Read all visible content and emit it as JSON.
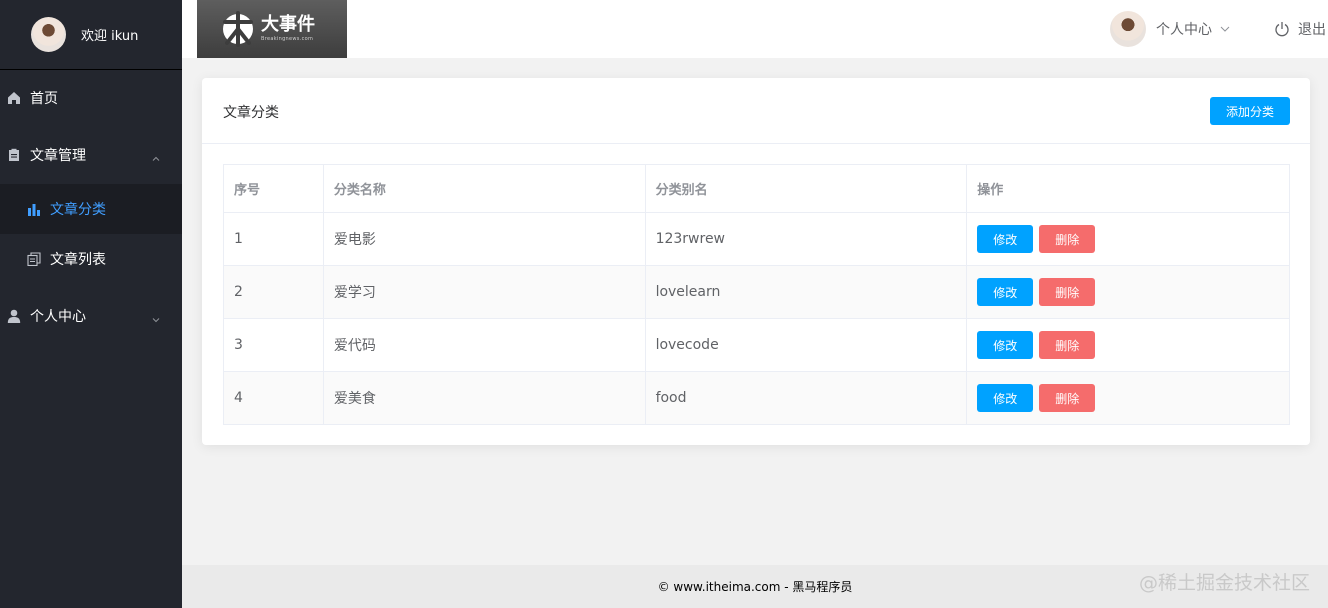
{
  "sidebar": {
    "welcome": "欢迎 ikun",
    "menu": [
      {
        "label": "首页",
        "icon": "home-icon"
      },
      {
        "label": "文章管理",
        "icon": "document-icon",
        "expanded": true
      },
      {
        "label": "文章分类",
        "icon": "bar-chart-icon",
        "active": true
      },
      {
        "label": "文章列表",
        "icon": "copy-icon"
      },
      {
        "label": "个人中心",
        "icon": "user-icon",
        "expanded": false
      }
    ]
  },
  "header": {
    "logo_title": "大事件",
    "logo_sub": "Breakingnews.com",
    "user_label": "个人中心",
    "logout_label": "退出"
  },
  "card": {
    "title": "文章分类",
    "add_button": "添加分类",
    "columns": [
      "序号",
      "分类名称",
      "分类别名",
      "操作"
    ],
    "rows": [
      {
        "index": "1",
        "name": "爱电影",
        "alias": "123rwrew"
      },
      {
        "index": "2",
        "name": "爱学习",
        "alias": "lovelearn"
      },
      {
        "index": "3",
        "name": "爱代码",
        "alias": "lovecode"
      },
      {
        "index": "4",
        "name": "爱美食",
        "alias": "food"
      }
    ],
    "edit_label": "修改",
    "delete_label": "删除"
  },
  "footer": {
    "text": "© www.itheima.com - 黑马程序员"
  },
  "watermark": "@稀土掘金技术社区",
  "colors": {
    "primary": "#00a2ff",
    "danger": "#f56c6c",
    "sidebar_bg": "#23262e",
    "active": "#409eff"
  }
}
